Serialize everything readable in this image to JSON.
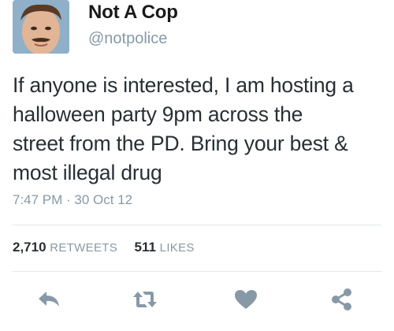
{
  "user": {
    "name": "Not A Cop",
    "handle": "@notpolice"
  },
  "tweet": {
    "lines": [
      "If anyone is interested, I am hosting a",
      "halloween party 9pm across the",
      "street from the PD. Bring your best &",
      "most illegal drug"
    ],
    "timestamp": "7:47 PM · 30 Oct 12"
  },
  "stats": {
    "retweets_count": "2,710",
    "retweets_label": "RETWEETS",
    "likes_count": "511",
    "likes_label": "LIKES"
  },
  "actions": {
    "icons": [
      "reply-icon",
      "retweet-icon",
      "like-icon",
      "share-icon"
    ],
    "color": "#8899a6"
  }
}
